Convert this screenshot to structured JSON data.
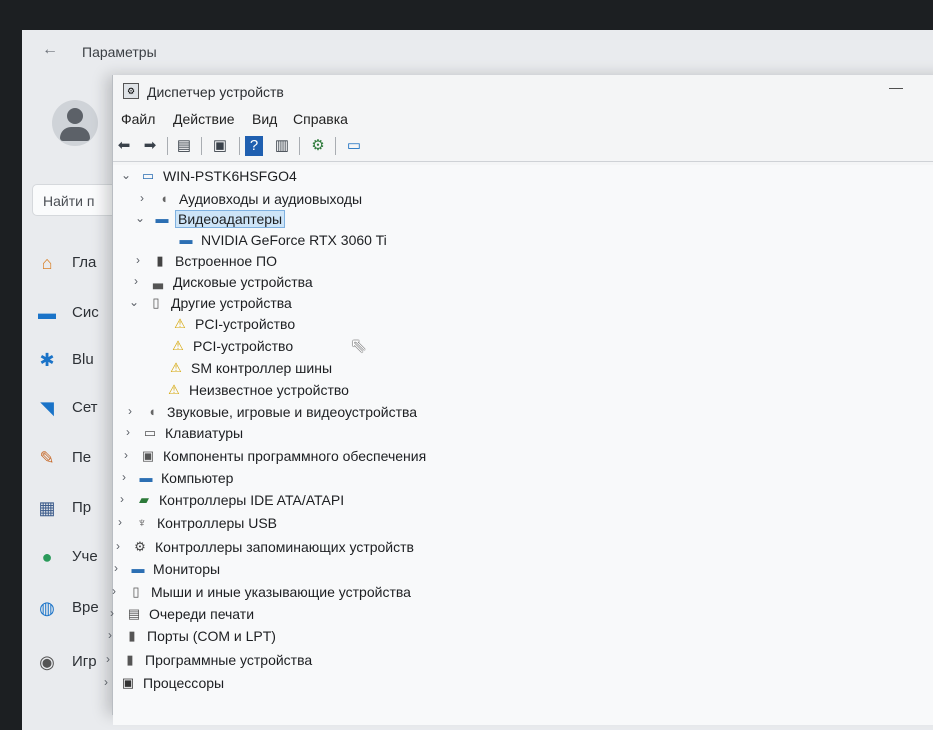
{
  "settings": {
    "title": "Параметры",
    "search_label": "Найти п",
    "nav": [
      {
        "label": "Гла",
        "icon": "home-icon"
      },
      {
        "label": "Сис",
        "icon": "monitor-icon"
      },
      {
        "label": "Blu",
        "icon": "bluetooth-icon"
      },
      {
        "label": "Сет",
        "icon": "wifi-icon"
      },
      {
        "label": "Пе",
        "icon": "brush-icon"
      },
      {
        "label": "Пр",
        "icon": "apps-icon"
      },
      {
        "label": "Уче",
        "icon": "account-icon"
      },
      {
        "label": "Вре",
        "icon": "globe-clock-icon"
      },
      {
        "label": "Игр",
        "icon": "gamepad-icon"
      }
    ]
  },
  "device_manager": {
    "title": "Диспетчер устройств",
    "menu": [
      "Файл",
      "Действие",
      "Вид",
      "Справка"
    ],
    "root": "WIN-PSTK6HSFGO4",
    "items": [
      {
        "label": "Аудиовходы и аудиовыходы",
        "icon": "audio-icon",
        "expanded": false
      },
      {
        "label": "Видеоадаптеры",
        "icon": "display-adapter-icon",
        "expanded": true,
        "selected": true
      },
      {
        "label": "NVIDIA GeForce RTX 3060 Ti",
        "icon": "gpu-icon",
        "child": true
      },
      {
        "label": "Встроенное ПО",
        "icon": "firmware-icon",
        "expanded": false
      },
      {
        "label": "Дисковые устройства",
        "icon": "disk-icon",
        "expanded": false
      },
      {
        "label": "Другие устройства",
        "icon": "unknown-device-icon",
        "expanded": true
      },
      {
        "label": "PCI-устройство",
        "icon": "warning-device-icon",
        "child": true
      },
      {
        "label": "PCI-устройство",
        "icon": "warning-device-icon",
        "child": true
      },
      {
        "label": "SM контроллер шины",
        "icon": "warning-device-icon",
        "child": true
      },
      {
        "label": "Неизвестное устройство",
        "icon": "warning-device-icon",
        "child": true
      },
      {
        "label": "Звуковые, игровые и видеоустройства",
        "icon": "sound-icon",
        "expanded": false
      },
      {
        "label": "Клавиатуры",
        "icon": "keyboard-icon",
        "expanded": false
      },
      {
        "label": "Компоненты программного обеспечения",
        "icon": "software-component-icon",
        "expanded": false
      },
      {
        "label": "Компьютер",
        "icon": "computer-icon",
        "expanded": false
      },
      {
        "label": "Контроллеры IDE ATA/ATAPI",
        "icon": "ide-icon",
        "expanded": false
      },
      {
        "label": "Контроллеры USB",
        "icon": "usb-icon",
        "expanded": false
      },
      {
        "label": "Контроллеры запоминающих устройств",
        "icon": "storage-controller-icon",
        "expanded": false
      },
      {
        "label": "Мониторы",
        "icon": "monitor-icon",
        "expanded": false
      },
      {
        "label": "Мыши и иные указывающие устройства",
        "icon": "mouse-icon",
        "expanded": false
      },
      {
        "label": "Очереди печати",
        "icon": "printer-icon",
        "expanded": false
      },
      {
        "label": "Порты (COM и LPT)",
        "icon": "port-icon",
        "expanded": false
      },
      {
        "label": "Программные устройства",
        "icon": "software-device-icon",
        "expanded": false
      },
      {
        "label": "Процессоры",
        "icon": "processor-icon",
        "expanded": false
      }
    ]
  },
  "colors": {
    "accent": "#0067c0",
    "selection": "#cde4f7",
    "warning": "#f2c200"
  }
}
